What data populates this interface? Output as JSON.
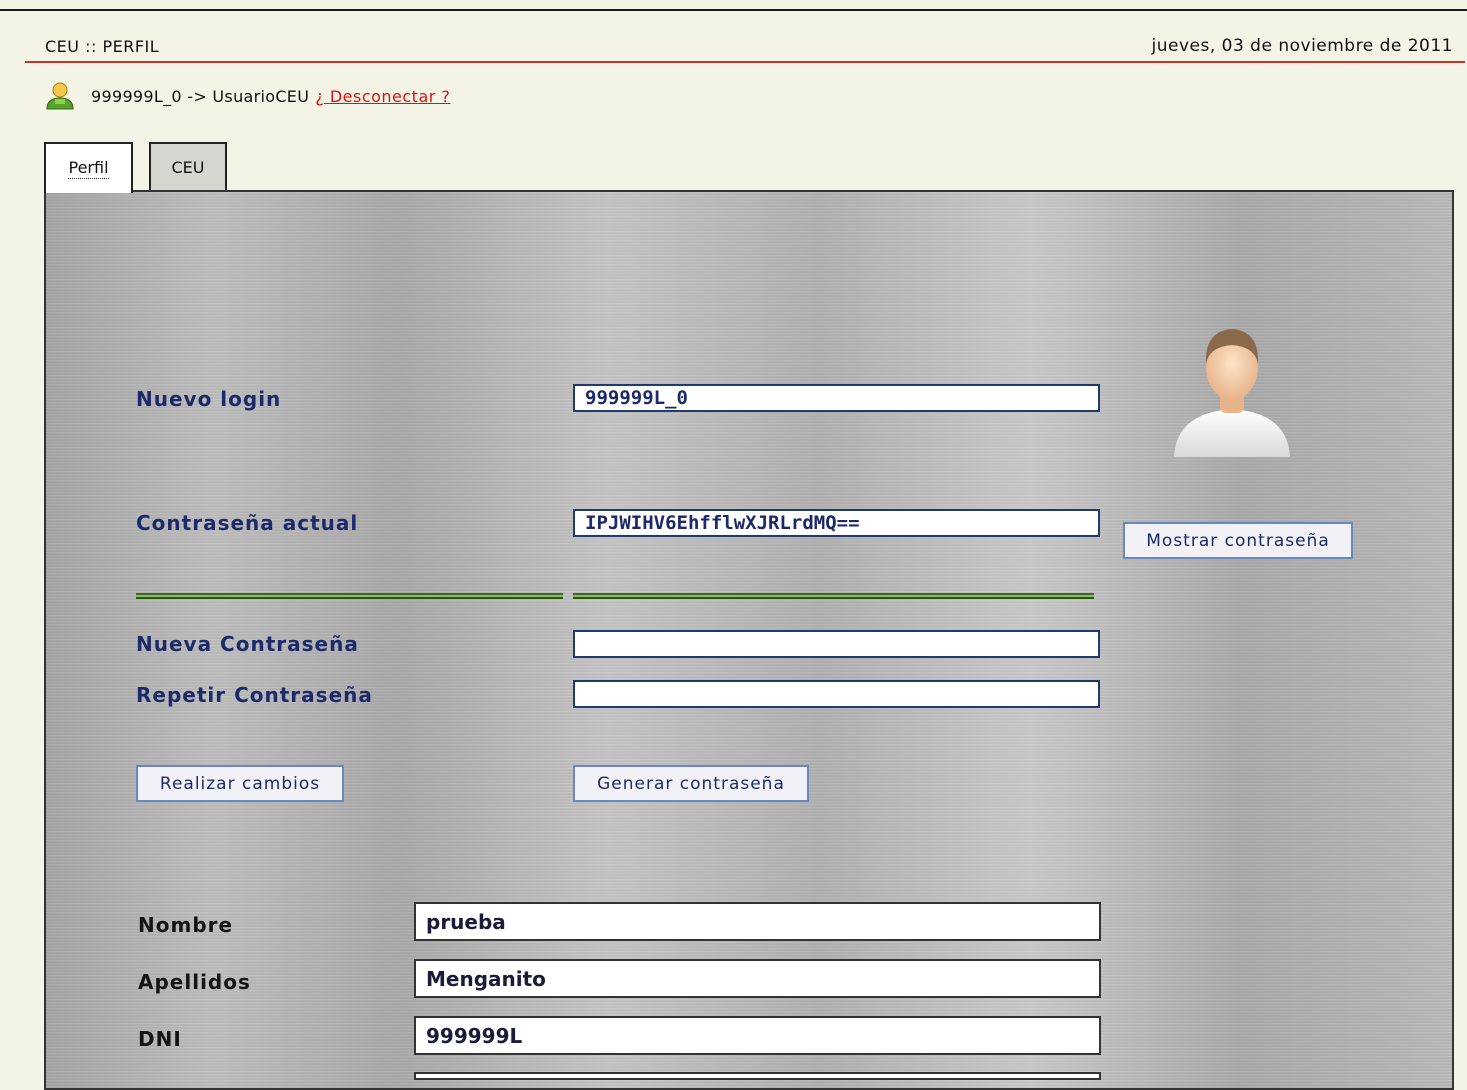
{
  "header": {
    "title": "CEU :: PERFIL",
    "date": "jueves, 03 de noviembre de 2011"
  },
  "user": {
    "session_text": "999999L_0 -> UsuarioCEU",
    "logout_link": "¿ Desconectar ?"
  },
  "tabs": [
    {
      "label": "Perfil",
      "active": true
    },
    {
      "label": "CEU",
      "active": false
    }
  ],
  "form": {
    "login_label": "Nuevo login",
    "login_value": "999999L_0",
    "current_password_label": "Contraseña actual",
    "current_password_value": "IPJWIHV6EhfflwXJRLrdMQ==",
    "show_password_button": "Mostrar contraseña",
    "new_password_label": "Nueva Contraseña",
    "new_password_value": "",
    "repeat_password_label": "Repetir Contraseña",
    "repeat_password_value": "",
    "apply_button": "Realizar cambios",
    "generate_button": "Generar contraseña"
  },
  "personal": {
    "name_label": "Nombre",
    "name_value": "prueba",
    "surname_label": "Apellidos",
    "surname_value": "Menganito",
    "dni_label": "DNI",
    "dni_value": "999999L"
  },
  "colors": {
    "accent_red": "#c0392b",
    "label_blue": "#1c2a6b",
    "link_red": "#e01010",
    "rule_green": "#3b6a1e"
  },
  "icons": {
    "user": "user-status-icon",
    "avatar": "user-avatar-icon"
  }
}
